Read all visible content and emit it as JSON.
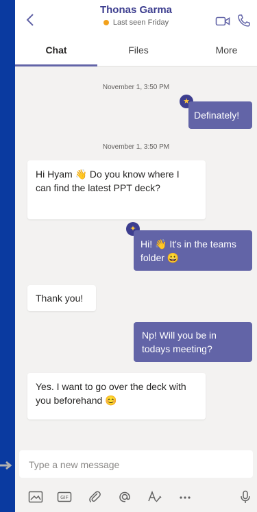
{
  "header": {
    "contact_name": "Thonas Garma",
    "status_text": "Last seen Friday",
    "status_color": "#f2a11c"
  },
  "tabs": [
    {
      "label": "Chat",
      "active": true
    },
    {
      "label": "Files",
      "active": false
    },
    {
      "label": "More",
      "active": false
    }
  ],
  "messages": [
    {
      "timestamp": "November 1, 3:50 PM"
    },
    {
      "direction": "out",
      "text": "Definately!",
      "reaction": "emoji"
    },
    {
      "timestamp": "November 1, 3:50 PM"
    },
    {
      "direction": "in",
      "text": "Hi Hyam 👋 Do you know where I can find the latest PPT deck?"
    },
    {
      "direction": "out",
      "text": "Hi! 👋 It's in the teams folder 😀",
      "reaction": "fire"
    },
    {
      "direction": "in",
      "text": "Thank you!"
    },
    {
      "direction": "out",
      "text": "Np! Will you be in todays meeting?"
    },
    {
      "direction": "in",
      "text": "Yes. I want to go over the deck with you beforehand 😊"
    }
  ],
  "composer": {
    "placeholder": "Type a new message"
  },
  "toolbar": [
    {
      "icon": "image-icon"
    },
    {
      "icon": "gif-icon"
    },
    {
      "icon": "attach-icon"
    },
    {
      "icon": "mention-icon"
    },
    {
      "icon": "format-icon"
    },
    {
      "icon": "more-icon"
    },
    {
      "icon": "microphone-icon"
    }
  ],
  "colors": {
    "accent": "#6264a7",
    "background": "#f3f2f1",
    "outer": "#0a3aa0"
  }
}
